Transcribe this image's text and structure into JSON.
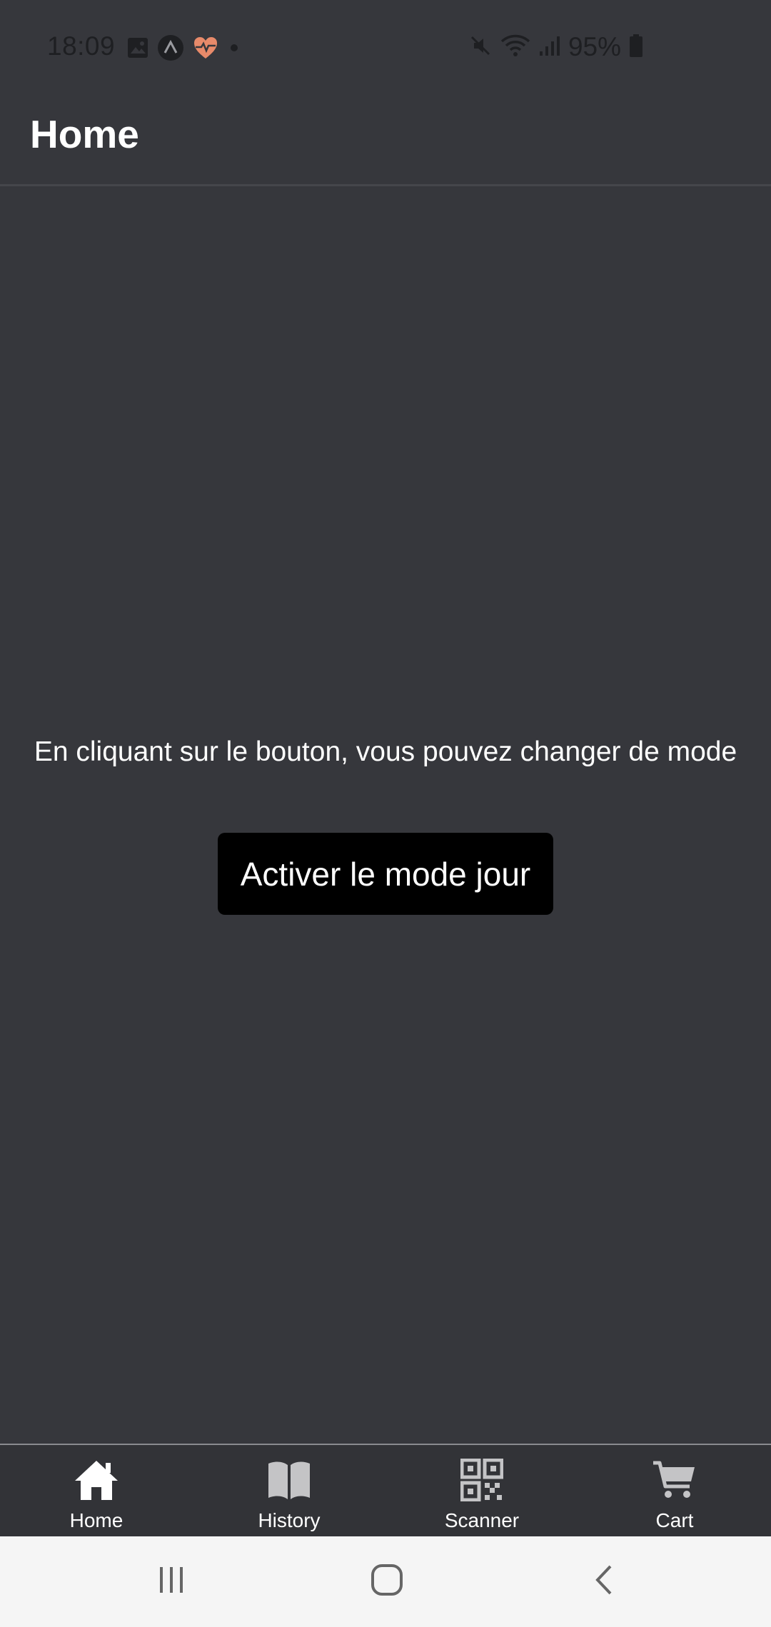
{
  "status_bar": {
    "time": "18:09",
    "battery": "95%",
    "left_icons": [
      "image-icon",
      "app-a-icon",
      "health-heart-icon",
      "dot-icon"
    ],
    "right_icons": [
      "mute-icon",
      "wifi-icon",
      "signal-icon",
      "battery-icon"
    ]
  },
  "header": {
    "title": "Home"
  },
  "main": {
    "message": "En cliquant sur le bouton, vous pouvez changer de mode",
    "button_label": "Activer le mode jour"
  },
  "tabs": [
    {
      "label": "Home",
      "icon": "home-icon",
      "active": true
    },
    {
      "label": "History",
      "icon": "book-icon",
      "active": false
    },
    {
      "label": "Scanner",
      "icon": "qr-code-icon",
      "active": false
    },
    {
      "label": "Cart",
      "icon": "cart-icon",
      "active": false
    }
  ],
  "nav_bar": {
    "buttons": [
      "recents-icon",
      "home-circle-icon",
      "back-icon"
    ]
  },
  "colors": {
    "background": "#36373c",
    "button": "#000000",
    "tab_bar": "#323337",
    "active_tab_icon": "#ffffff",
    "inactive_tab_icon": "#c4c4c6",
    "nav_bar": "#f5f5f5"
  }
}
